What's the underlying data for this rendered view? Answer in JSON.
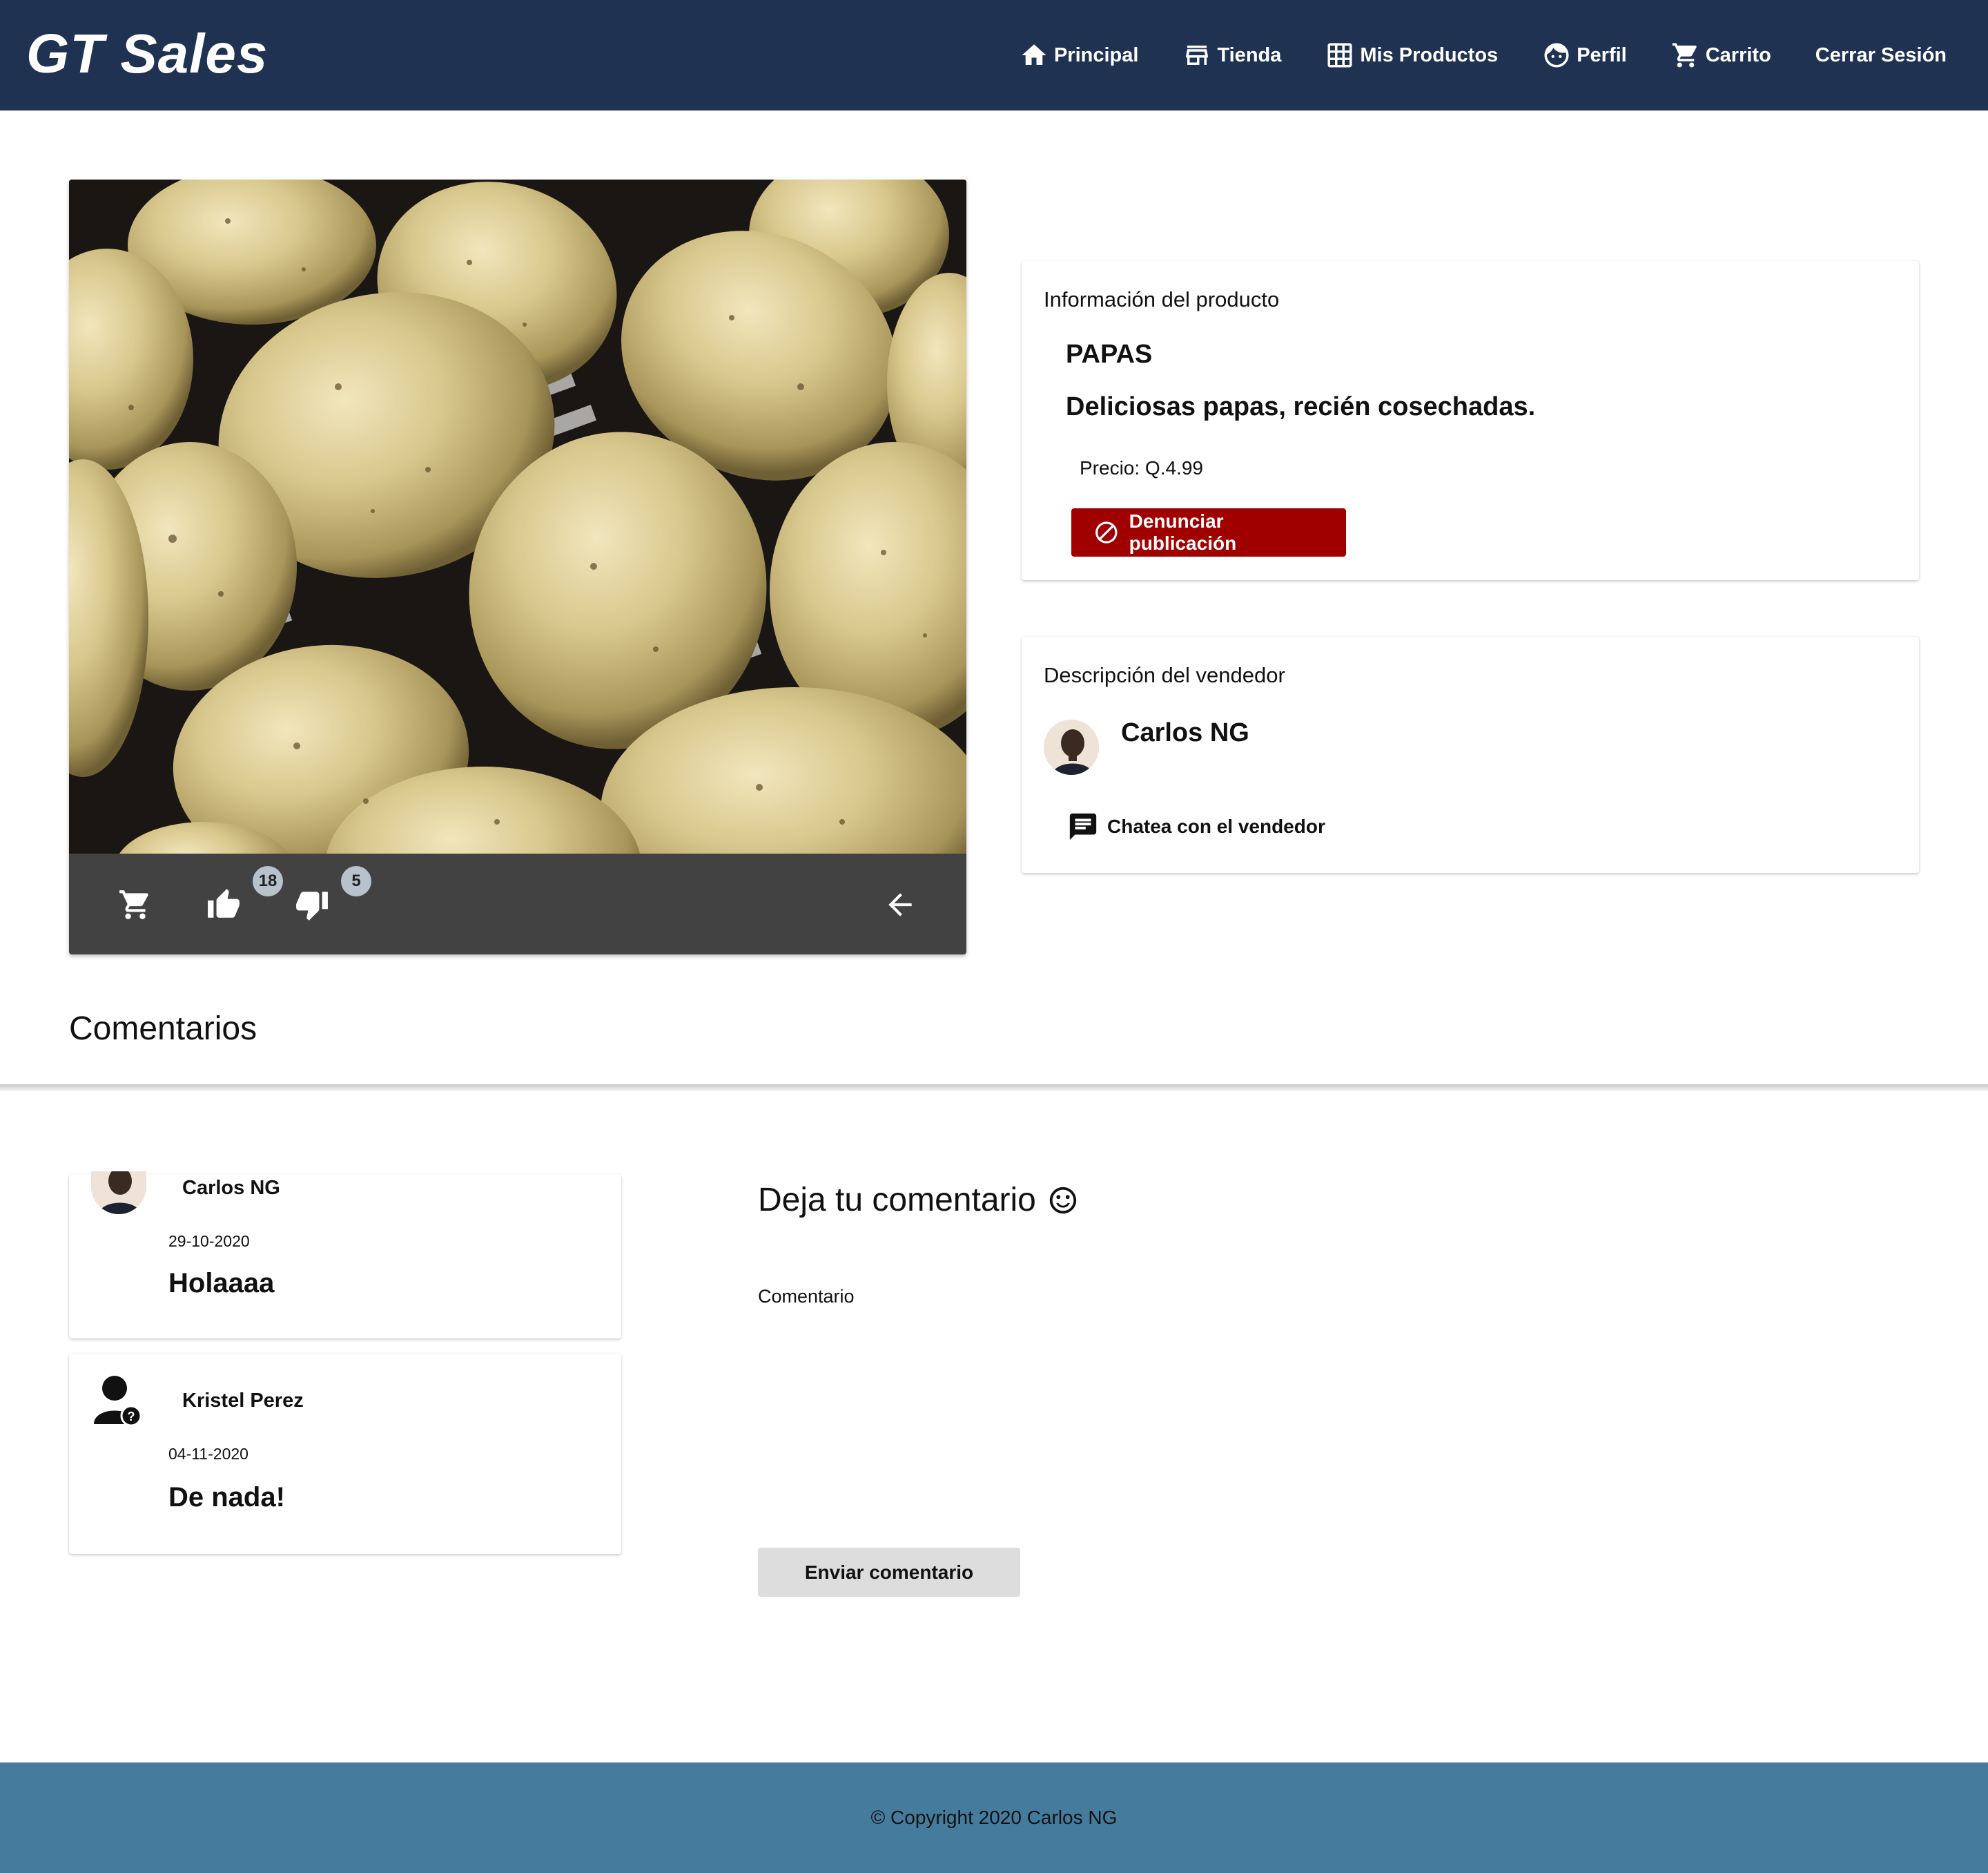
{
  "header": {
    "brand": "GT Sales",
    "nav": [
      {
        "label": "Principal",
        "icon": "home-icon"
      },
      {
        "label": "Tienda",
        "icon": "store-icon"
      },
      {
        "label": "Mis Productos",
        "icon": "grid-icon"
      },
      {
        "label": "Perfil",
        "icon": "face-icon"
      },
      {
        "label": "Carrito",
        "icon": "cart-icon"
      },
      {
        "label": "Cerrar Sesión",
        "icon": ""
      }
    ]
  },
  "product": {
    "likes": "18",
    "dislikes": "5",
    "info_title": "Información del producto",
    "name": "PAPAS",
    "description": "Deliciosas papas, recién cosechadas.",
    "price": "Precio: Q.4.99",
    "report_label": "Denunciar publicación"
  },
  "seller": {
    "title": "Descripción del vendedor",
    "name": "Carlos NG",
    "chat_label": "Chatea con el vendedor"
  },
  "comments": {
    "title": "Comentarios",
    "items": [
      {
        "user": "Carlos NG",
        "date": "29-10-2020",
        "text": "Holaaaa",
        "avatar": "photo"
      },
      {
        "user": "Kristel Perez",
        "date": "04-11-2020",
        "text": "De nada!",
        "avatar": "person-icon"
      }
    ],
    "form_title": "Deja tu comentario",
    "field_label": "Comentario",
    "submit_label": "Enviar comentario"
  },
  "footer": {
    "text": "© Copyright 2020 Carlos NG"
  },
  "colors": {
    "navbar": "#1f3252",
    "report": "#a10000",
    "footer": "#457b9d",
    "media_actions": "#424242"
  }
}
